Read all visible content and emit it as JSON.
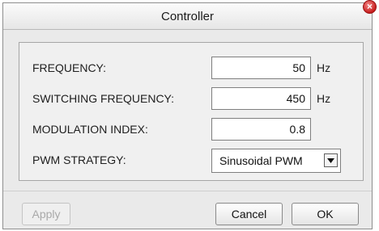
{
  "window": {
    "title": "Controller"
  },
  "form": {
    "frequency": {
      "label": "FREQUENCY:",
      "value": "50",
      "unit": "Hz"
    },
    "switching_frequency": {
      "label": "SWITCHING FREQUENCY:",
      "value": "450",
      "unit": "Hz"
    },
    "modulation_index": {
      "label": "MODULATION INDEX:",
      "value": "0.8"
    },
    "pwm_strategy": {
      "label": "PWM STRATEGY:",
      "selected": "Sinusoidal PWM"
    }
  },
  "buttons": {
    "apply": "Apply",
    "cancel": "Cancel",
    "ok": "OK"
  },
  "icons": {
    "close": "close-icon",
    "dropdown": "chevron-down-icon"
  },
  "colors": {
    "close_red": "#c81e1e",
    "disabled_text": "#a9a9a9"
  }
}
